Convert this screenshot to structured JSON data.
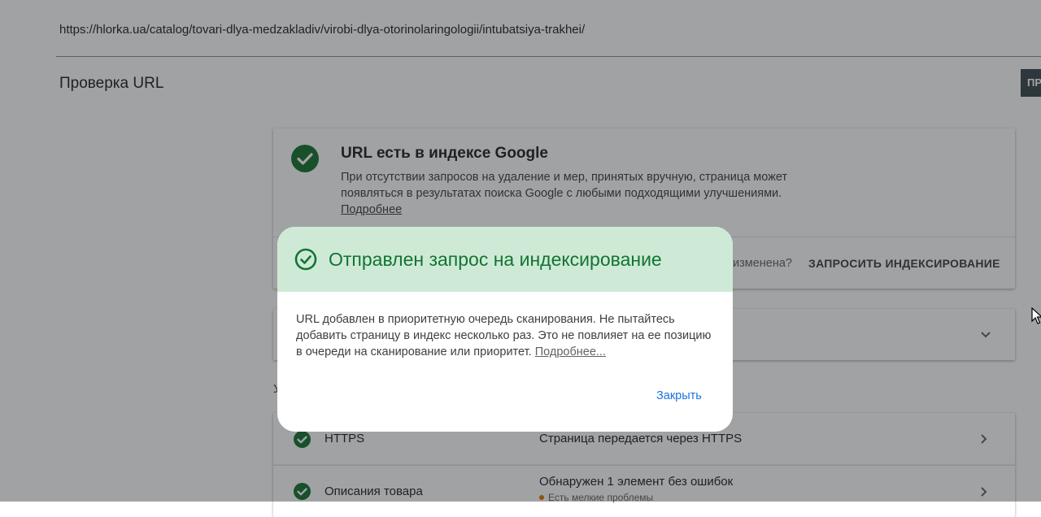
{
  "url_bar": {
    "url": "https://hlorka.ua/catalog/tovari-dlya-medzakladiv/virobi-dlya-otorinolaringologii/intubatsiya-trakhei/"
  },
  "page": {
    "title": "Проверка URL",
    "top_right_button": "ПР"
  },
  "index_card": {
    "title": "URL есть в индексе Google",
    "description": "При отсутствии запросов на удаление и мер, принятых вручную, страница может появляться в результатах поиска Google с любыми подходящими улучшениями.",
    "more_link": "Подробнее",
    "changed_question": "изменена?",
    "request_button": "ЗАПРОСИТЬ ИНДЕКСИРОВАНИЕ"
  },
  "section_partial_letter": "У",
  "rows": [
    {
      "label": "HTTPS",
      "value": "Страница передается через HTTPS",
      "sub": ""
    },
    {
      "label": "Описания товара",
      "value": "Обнаружен 1 элемент без ошибок",
      "sub": "Есть мелкие проблемы"
    }
  ],
  "dialog": {
    "title": "Отправлен запрос на индексирование",
    "body": "URL добавлен в приоритетную очередь сканирования. Не пытайтесь добавить страницу в индекс несколько раз. Это не повлияет на ее позицию в очереди на сканирование или приоритет.",
    "more_link": "Подробнее...",
    "close_button": "Закрыть"
  },
  "colors": {
    "success_green": "#137333",
    "dialog_header_bg": "#ceead6",
    "link_blue": "#1a73e8",
    "warning_orange": "#e37400"
  }
}
